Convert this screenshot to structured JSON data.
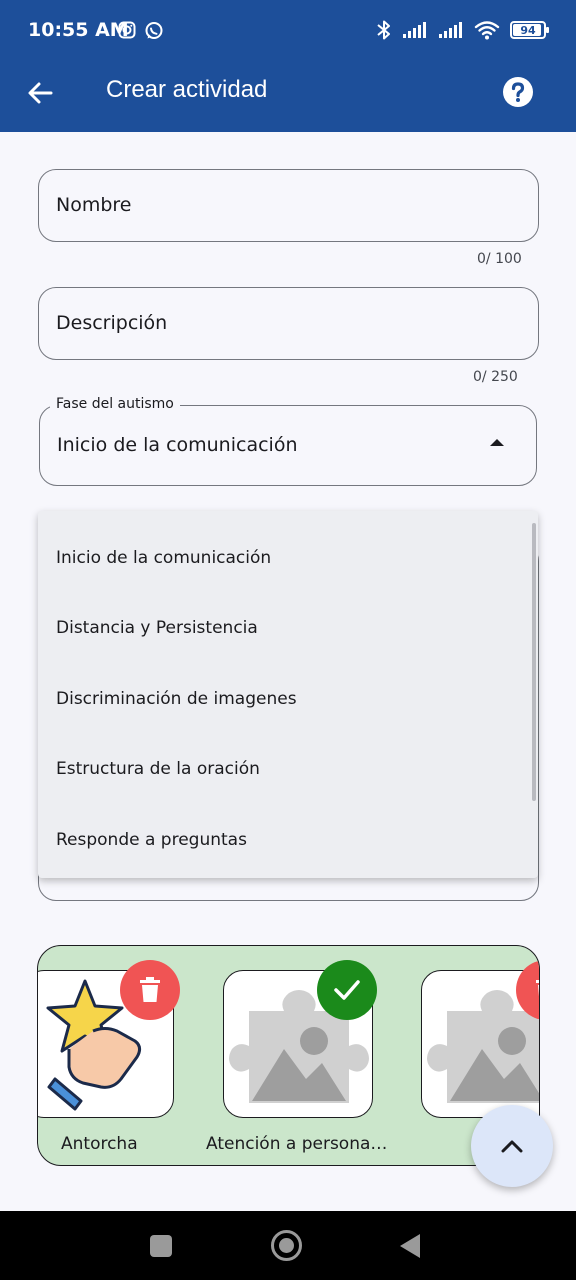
{
  "status_bar": {
    "time": "10:55 AM",
    "left_icons": [
      "instagram-icon",
      "whatsapp-icon"
    ],
    "right_icons": [
      "bluetooth-icon",
      "signal-icon",
      "signal-icon",
      "wifi-icon"
    ],
    "battery_level": "94"
  },
  "app_bar": {
    "title": "Crear actividad",
    "back_icon": "arrow-back-icon",
    "help_icon": "help-icon"
  },
  "form": {
    "name_field": {
      "value": "Nombre",
      "counter": "0/ 100"
    },
    "description_field": {
      "value": "Descripción",
      "counter": "0/ 250"
    },
    "phase_dropdown": {
      "label": "Fase del autismo",
      "selected": "Inicio de la comunicación"
    }
  },
  "dropdown_menu": {
    "options": [
      "Inicio de la comunicación",
      "Distancia y Persistencia",
      "Discriminación de imagenes",
      "Estructura de la oración",
      "Responde a preguntas"
    ]
  },
  "gallery": {
    "cards": [
      {
        "label": "Antorcha",
        "badge": "delete-icon"
      },
      {
        "label": "Atención a persona…",
        "badge": "check-icon"
      },
      {
        "label": "",
        "badge": "delete-icon"
      }
    ]
  },
  "fab": {
    "icon": "chevron-up-icon"
  },
  "nav_bar": {
    "buttons": [
      "recents-icon",
      "home-icon",
      "back-icon"
    ]
  },
  "colors": {
    "primary": "#1d4f9a",
    "background": "#f7f7fc",
    "gallery_bg": "#cbe6cb",
    "delete_badge": "#f05454",
    "check_badge": "#1b8a1b",
    "fab_bg": "#dce6f9"
  }
}
